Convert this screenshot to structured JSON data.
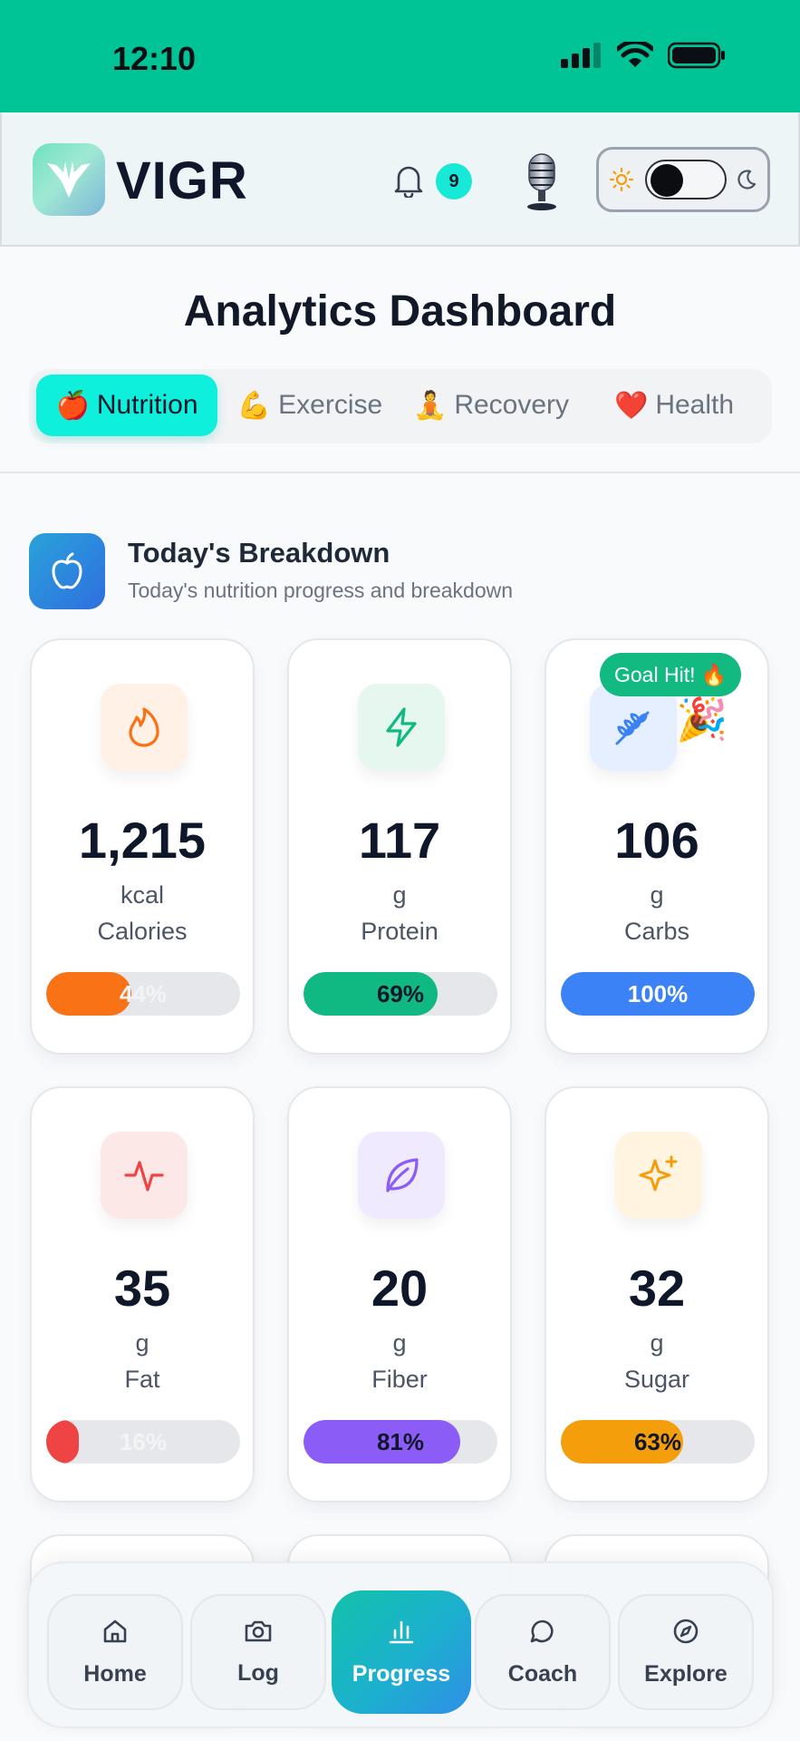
{
  "status_bar": {
    "time": "12:10"
  },
  "header": {
    "logo_text": "VIGR",
    "notification_count": "9",
    "icons": [
      "bell-icon",
      "microphone-icon",
      "sun-icon",
      "moon-icon"
    ]
  },
  "page": {
    "title": "Analytics Dashboard"
  },
  "tabs": [
    {
      "emoji": "🍎",
      "label": "Nutrition",
      "active": true
    },
    {
      "emoji": "💪",
      "label": "Exercise",
      "active": false
    },
    {
      "emoji": "🧘",
      "label": "Recovery",
      "active": false
    },
    {
      "emoji": "❤️",
      "label": "Health",
      "active": false
    }
  ],
  "section": {
    "title": "Today's Breakdown",
    "subtitle": "Today's nutrition progress and breakdown"
  },
  "goal_badge": {
    "text": "Goal Hit!",
    "emoji": "🔥",
    "confetti": "🎉"
  },
  "cards": [
    {
      "value": "1,215",
      "unit": "kcal",
      "label": "Calories",
      "percent_text": "44%",
      "progress": 0.44,
      "icon": "flame-icon",
      "color": "#f97316",
      "icon_bg": "#fff1e6"
    },
    {
      "value": "117",
      "unit": "g",
      "label": "Protein",
      "percent_text": "69%",
      "progress": 0.69,
      "icon": "lightning-icon",
      "color": "#10b981",
      "icon_bg": "#e6f7ef"
    },
    {
      "value": "106",
      "unit": "g",
      "label": "Carbs",
      "percent_text": "100%",
      "progress": 1.0,
      "icon": "wheat-icon",
      "color": "#3b82f6",
      "icon_bg": "#e6efff"
    },
    {
      "value": "35",
      "unit": "g",
      "label": "Fat",
      "percent_text": "16%",
      "progress": 0.16,
      "icon": "pulse-icon",
      "color": "#ef4444",
      "icon_bg": "#fde8e8"
    },
    {
      "value": "20",
      "unit": "g",
      "label": "Fiber",
      "percent_text": "81%",
      "progress": 0.81,
      "icon": "leaf-icon",
      "color": "#8b5cf6",
      "icon_bg": "#f0eaff"
    },
    {
      "value": "32",
      "unit": "g",
      "label": "Sugar",
      "percent_text": "63%",
      "progress": 0.63,
      "icon": "sparkle-icon",
      "color": "#f59e0b",
      "icon_bg": "#fff4e0"
    }
  ],
  "bottom_nav": [
    {
      "label": "Home",
      "icon": "home-icon",
      "active": false
    },
    {
      "label": "Log",
      "icon": "camera-icon",
      "active": false
    },
    {
      "label": "Progress",
      "icon": "bar-chart-icon",
      "active": true
    },
    {
      "label": "Coach",
      "icon": "chat-icon",
      "active": false
    },
    {
      "label": "Explore",
      "icon": "compass-icon",
      "active": false
    }
  ]
}
